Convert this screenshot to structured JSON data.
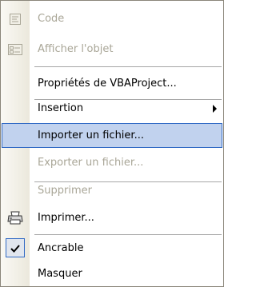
{
  "menu": {
    "items": [
      {
        "label": "Code",
        "icon": "view-code-icon",
        "disabled": true
      },
      {
        "label": "Afficher l'objet",
        "icon": "view-object-icon",
        "disabled": true
      },
      {
        "label": "Propriétés de VBAProject...",
        "disabled": false
      },
      {
        "label": "Insertion",
        "disabled": false,
        "submenu": true
      },
      {
        "label": "Importer un fichier...",
        "disabled": false,
        "highlighted": true
      },
      {
        "label": "Exporter un fichier...",
        "disabled": true
      },
      {
        "label": "Supprimer",
        "disabled": true
      },
      {
        "label": "Imprimer...",
        "icon": "printer-icon",
        "disabled": false
      },
      {
        "label": "Ancrable",
        "icon": "checkmark-icon",
        "checked": true,
        "disabled": false
      },
      {
        "label": "Masquer",
        "disabled": false
      }
    ]
  },
  "colors": {
    "highlight_fill": "#c1d2ee",
    "highlight_border": "#316ac5",
    "disabled_text": "#a9a697"
  }
}
